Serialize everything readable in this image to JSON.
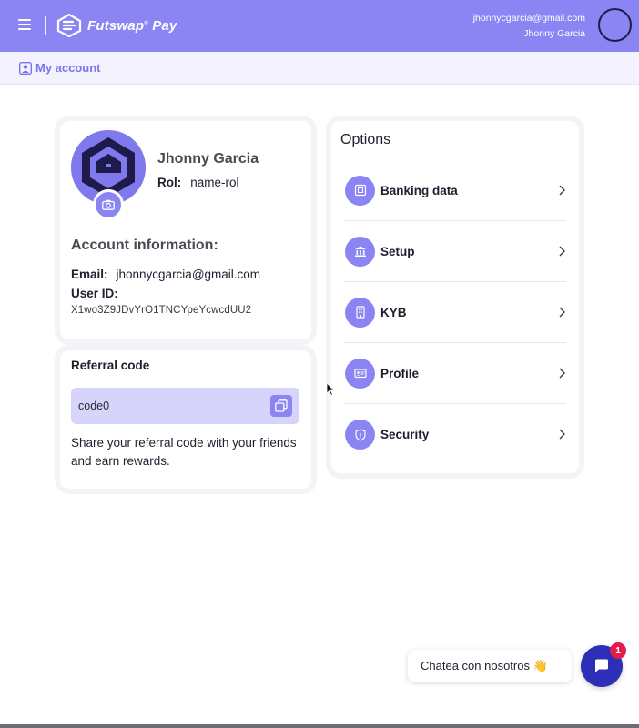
{
  "header": {
    "brand": "Futswap",
    "brand_suffix": "Pay",
    "user_email": "jhonnycgarcia@gmail.com",
    "user_name": "Jhonny Garcia",
    "bg_color": "#8b85f4"
  },
  "subheader": {
    "title": "My account",
    "icon": "account-icon"
  },
  "profile": {
    "name": "Jhonny Garcia",
    "rol_label": "Rol:",
    "rol_value": "name-rol",
    "section_title": "Account information:",
    "email_label": "Email:",
    "email_value": "jhonnycgarcia@gmail.com",
    "userid_label": "User ID:",
    "userid_value": "X1wo3Z9JDvYrO1TNCYpeYcwcdUU2"
  },
  "referral": {
    "title": "Referral code",
    "code": "code0",
    "description": "Share your referral code with your friends and earn rewards."
  },
  "options": {
    "title": "Options",
    "items": [
      {
        "label": "Banking data",
        "icon": "bank-card-icon"
      },
      {
        "label": "Setup",
        "icon": "institution-icon"
      },
      {
        "label": "KYB",
        "icon": "building-icon"
      },
      {
        "label": "Profile",
        "icon": "id-card-icon"
      },
      {
        "label": "Security",
        "icon": "shield-icon"
      }
    ]
  },
  "chat": {
    "prompt": "Chatea con nosotros 👋",
    "badge_count": "1",
    "button_color": "#2d2fb8"
  }
}
